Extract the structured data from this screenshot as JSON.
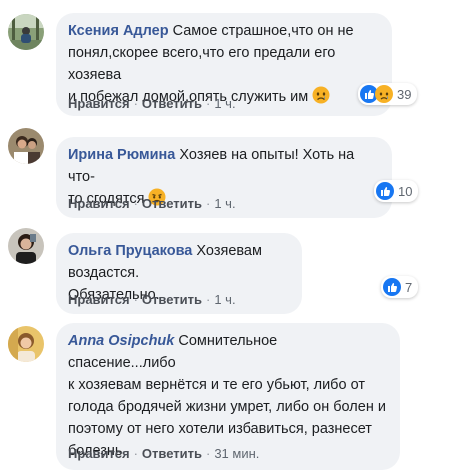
{
  "comments": [
    {
      "author": "Ксения Адлер",
      "text_lines": [
        "Самое страшное,что он не",
        "понял,скорее всего,что его предали его хозяева",
        "и побежал домой,опять служить им"
      ],
      "like_label": "Нравится",
      "reply_label": "Ответить",
      "time": "1 ч.",
      "reactions": [
        "like-icon",
        "sad-icon"
      ],
      "reaction_count": "39"
    },
    {
      "author": "Ирина Рюмина",
      "text_lines": [
        "Хозяев на опыты! Хоть на что-",
        "то сгодятся"
      ],
      "like_label": "Нравится",
      "reply_label": "Ответить",
      "time": "1 ч.",
      "reactions": [
        "like-icon"
      ],
      "reaction_count": "10"
    },
    {
      "author": "Ольга Пруцакова",
      "text_lines": [
        "Хозяевам воздастся.",
        "Обязательно."
      ],
      "like_label": "Нравится",
      "reply_label": "Ответить",
      "time": "1 ч.",
      "reactions": [
        "like-icon"
      ],
      "reaction_count": "7"
    },
    {
      "author_first": "Anna",
      "author_last": "Osipchuk",
      "text_lines": [
        "Сомнительное спасение...либо",
        "к хозяевам вернётся и те его убьют, либо от",
        "голода бродячей жизни умрет, либо он болен и",
        "поэтому от него хотели избавиться, разнесет",
        "болезнь"
      ],
      "like_label": "Нравится",
      "reply_label": "Ответить",
      "time": "31 мин."
    }
  ],
  "colors": {
    "author": "#385898",
    "bubble": "#f0f2f5",
    "like_blue": "#1877f2",
    "sad_yellow": "#f7b125",
    "meta": "#606770"
  }
}
